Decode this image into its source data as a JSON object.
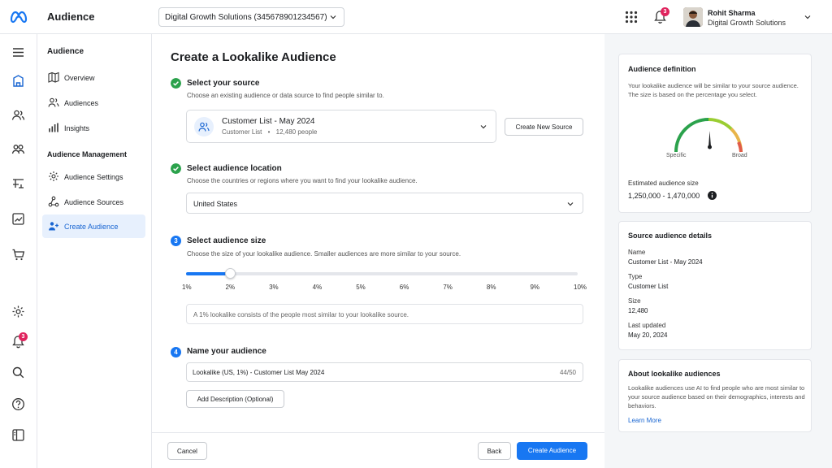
{
  "topbar": {
    "app_title": "Audience",
    "account_select": "Digital Growth Solutions (345678901234567)",
    "notifications_count": "3",
    "user_name": "Rohit Sharma",
    "user_org": "Digital Growth Solutions"
  },
  "rail": {
    "icons": [
      "menu-icon",
      "business-icon",
      "people-icon",
      "audience-icon",
      "tools-icon",
      "chart-icon",
      "cart-icon",
      "settings-icon",
      "bell-icon",
      "search-icon",
      "help-icon",
      "panel-icon"
    ],
    "bell_count": "3"
  },
  "sidebar": {
    "heading": "Audience",
    "items": [
      {
        "label": "Overview",
        "icon": "map-icon"
      },
      {
        "label": "Audiences",
        "icon": "people-icon"
      },
      {
        "label": "Insights",
        "icon": "bars-icon"
      }
    ],
    "management_heading": "Audience Management",
    "management_items": [
      {
        "label": "Audience Settings",
        "icon": "gear-icon"
      },
      {
        "label": "Audience Sources",
        "icon": "sources-icon"
      },
      {
        "label": "Create Audience",
        "icon": "add-people-icon"
      }
    ]
  },
  "main": {
    "title": "Create a Lookalike Audience",
    "step1": {
      "title": "Select your source",
      "desc": "Choose an existing audience or data source to find people similar to.",
      "source_name": "Customer List - May 2024",
      "source_type": "Customer List",
      "source_separator": "•",
      "source_size": "12,480 people",
      "new_source_label": "Create New Source"
    },
    "step2": {
      "title": "Select audience location",
      "desc": "Choose the countries or regions where you want to find your lookalike audience.",
      "location": "United States"
    },
    "step3": {
      "number": "3",
      "title": "Select audience size",
      "desc": "Choose the size of your lookalike audience. Smaller audiences are more similar to your source.",
      "ticks": [
        "1%",
        "2%",
        "3%",
        "4%",
        "5%",
        "6%",
        "7%",
        "8%",
        "9%",
        "10%"
      ],
      "selected_percent": 2,
      "info": "A 1% lookalike consists of the people most similar to your lookalike source."
    },
    "step4": {
      "number": "4",
      "title": "Name your audience",
      "name_value": "Lookalike (US, 1%) - Customer List May 2024",
      "char_count": "44/50",
      "add_description_label": "Add Description (Optional)"
    },
    "footer": {
      "cancel_label": "Cancel",
      "back_label": "Back",
      "create_label": "Create Audience"
    }
  },
  "definition_panel": {
    "title": "Audience definition",
    "desc": "Your lookalike audience will be similar to your source audience. The size is based on the percentage you select.",
    "specific_label": "Specific",
    "broad_label": "Broad",
    "est_label": "Estimated audience size",
    "est_value": "1,250,000 - 1,470,000"
  },
  "source_panel": {
    "title": "Source audience details",
    "name_label": "Name",
    "name_value": "Customer List - May 2024",
    "type_label": "Type",
    "type_value": "Customer List",
    "size_label": "Size",
    "size_value": "12,480",
    "updated_label": "Last updated",
    "updated_value": "May 20, 2024"
  },
  "about_panel": {
    "title": "About lookalike audiences",
    "desc": "Lookalike audiences use AI to find people who are most similar to your source audience based on their demographics, interests and behaviors.",
    "learn_more": "Learn More"
  },
  "colors": {
    "accent": "#1877f2",
    "success": "#2ba24c",
    "badge": "#e0245e"
  }
}
